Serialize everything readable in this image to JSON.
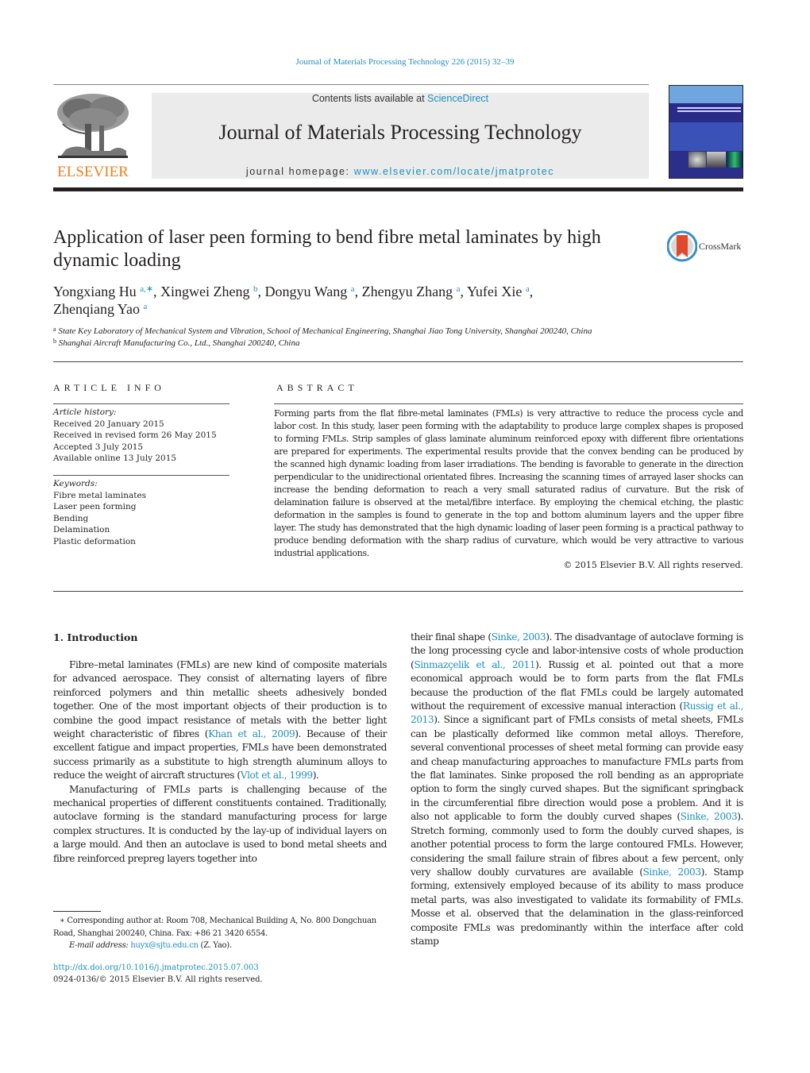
{
  "header": {
    "journal_reference": "Journal of Materials Processing Technology 226 (2015) 32–39",
    "publisher_logo_text": "ELSEVIER",
    "contents_prefix": "Contents lists available at ",
    "contents_link": "ScienceDirect",
    "journal_title": "Journal of Materials Processing Technology",
    "homepage_prefix": "journal homepage: ",
    "homepage_link": "www.elsevier.com/locate/jmatprotec",
    "brand_color": "#f07f1e",
    "link_color": "#1f8fbf"
  },
  "crossmark": {
    "label": "CrossMark"
  },
  "article": {
    "title": "Application of laser peen forming to bend fibre metal laminates by high dynamic loading",
    "authors": [
      {
        "name": "Yongxiang Hu",
        "sup": "a,∗",
        "sep": ", "
      },
      {
        "name": "Xingwei Zheng",
        "sup": "b",
        "sep": ", "
      },
      {
        "name": "Dongyu Wang",
        "sup": "a",
        "sep": ", "
      },
      {
        "name": "Zhengyu Zhang",
        "sup": "a",
        "sep": ", "
      },
      {
        "name": "Yufei Xie",
        "sup": "a",
        "sep": ", "
      },
      {
        "name": "Zhenqiang Yao",
        "sup": "a",
        "sep": ""
      }
    ],
    "affiliations": [
      {
        "mark": "a",
        "text": "State Key Laboratory of Mechanical System and Vibration, School of Mechanical Engineering, Shanghai Jiao Tong University, Shanghai 200240, China"
      },
      {
        "mark": "b",
        "text": "Shanghai Aircraft Manufacturing Co., Ltd., Shanghai 200240, China"
      }
    ]
  },
  "article_info": {
    "heading": "ARTICLE INFO",
    "history_label": "Article history:",
    "history": [
      "Received 20 January 2015",
      "Received in revised form 26 May 2015",
      "Accepted 3 July 2015",
      "Available online 13 July 2015"
    ],
    "keywords_label": "Keywords:",
    "keywords": [
      "Fibre metal laminates",
      "Laser peen forming",
      "Bending",
      "Delamination",
      "Plastic deformation"
    ]
  },
  "abstract": {
    "heading": "ABSTRACT",
    "text": "Forming parts from the flat fibre-metal laminates (FMLs) is very attractive to reduce the process cycle and labor cost. In this study, laser peen forming with the adaptability to produce large complex shapes is proposed to forming FMLs. Strip samples of glass laminate aluminum reinforced epoxy with different fibre orientations are prepared for experiments. The experimental results provide that the convex bending can be produced by the scanned high dynamic loading from laser irradiations. The bending is favorable to generate in the direction perpendicular to the unidirectional orientated fibres. Increasing the scanning times of arrayed laser shocks can increase the bending deformation to reach a very small saturated radius of curvature. But the risk of delamination failure is observed at the metal/fibre interface. By employing the chemical etching, the plastic deformation in the samples is found to generate in the top and bottom aluminum layers and the upper fibre layer. The study has demonstrated that the high dynamic loading of laser peen forming is a practical pathway to produce bending deformation with the sharp radius of curvature, which would be very attractive to various industrial applications.",
    "copyright": "© 2015 Elsevier B.V. All rights reserved."
  },
  "body": {
    "section_heading": "1.  Introduction",
    "left_paragraphs": [
      [
        {
          "t": "Fibre–metal laminates (FMLs) are new kind of composite materials for advanced aerospace. They consist of alternating layers of fibre reinforced polymers and thin metallic sheets adhesively bonded together. One of the most important objects of their production is to combine the good impact resistance of metals with the better light weight characteristic of fibres ("
        },
        {
          "t": "Khan et al., 2009",
          "link": true
        },
        {
          "t": "). Because of their excellent fatigue and impact properties, FMLs have been demonstrated success primarily as a substitute to high strength aluminum alloys to reduce the weight of aircraft structures ("
        },
        {
          "t": "Vlot et al., 1999",
          "link": true
        },
        {
          "t": ")."
        }
      ],
      [
        {
          "t": "Manufacturing of FMLs parts is challenging because of the mechanical properties of different constituents contained. Traditionally, autoclave forming is the standard manufacturing process for large complex structures. It is conducted by the lay-up of individual layers on a large mould. And then an autoclave is used to bond metal sheets and fibre reinforced prepreg layers together into"
        }
      ]
    ],
    "right_paragraphs": [
      [
        {
          "t": "their final shape ("
        },
        {
          "t": "Sinke, 2003",
          "link": true
        },
        {
          "t": "). The disadvantage of autoclave forming is the long processing cycle and labor-intensive costs of whole production ("
        },
        {
          "t": "Sinmazçelik et al., 2011",
          "link": true
        },
        {
          "t": "). Russig et al. pointed out that a more economical approach would be to form parts from the flat FMLs because the production of the flat FMLs could be largely automated without the requirement of excessive manual interaction ("
        },
        {
          "t": "Russig et al., 2013",
          "link": true
        },
        {
          "t": "). Since a significant part of FMLs consists of metal sheets, FMLs can be plastically deformed like common metal alloys. Therefore, several conventional processes of sheet metal forming can provide easy and cheap manufacturing approaches to manufacture FMLs parts from the flat laminates. Sinke proposed the roll bending as an appropriate option to form the singly curved shapes. But the significant springback in the circumferential fibre direction would pose a problem. And it is also not applicable to form the doubly curved shapes ("
        },
        {
          "t": "Sinke, 2003",
          "link": true
        },
        {
          "t": "). Stretch forming, commonly used to form the doubly curved shapes, is another potential process to form the large contoured FMLs. However, considering the small failure strain of fibres about a few percent, only very shallow doubly curvatures are available ("
        },
        {
          "t": "Sinke, 2003",
          "link": true
        },
        {
          "t": "). Stamp forming, extensively employed because of its ability to mass produce metal parts, was also investigated to validate its formability of FMLs. Mosse et al. observed that the delamination in the glass-reinforced composite FMLs was predominantly within the interface after cold stamp"
        }
      ]
    ]
  },
  "footnotes": {
    "corresponding": "∗ Corresponding author at: Room 708, Mechanical Building A, No. 800 Dongchuan Road, Shanghai 200240, China. Fax: +86 21 3420 6554.",
    "email_label": "E-mail address: ",
    "email": "huyx@sjtu.edu.cn",
    "email_suffix": " (Z. Yao).",
    "doi": "http://dx.doi.org/10.1016/j.jmatprotec.2015.07.003",
    "issn_line": "0924-0136/© 2015 Elsevier B.V. All rights reserved."
  }
}
